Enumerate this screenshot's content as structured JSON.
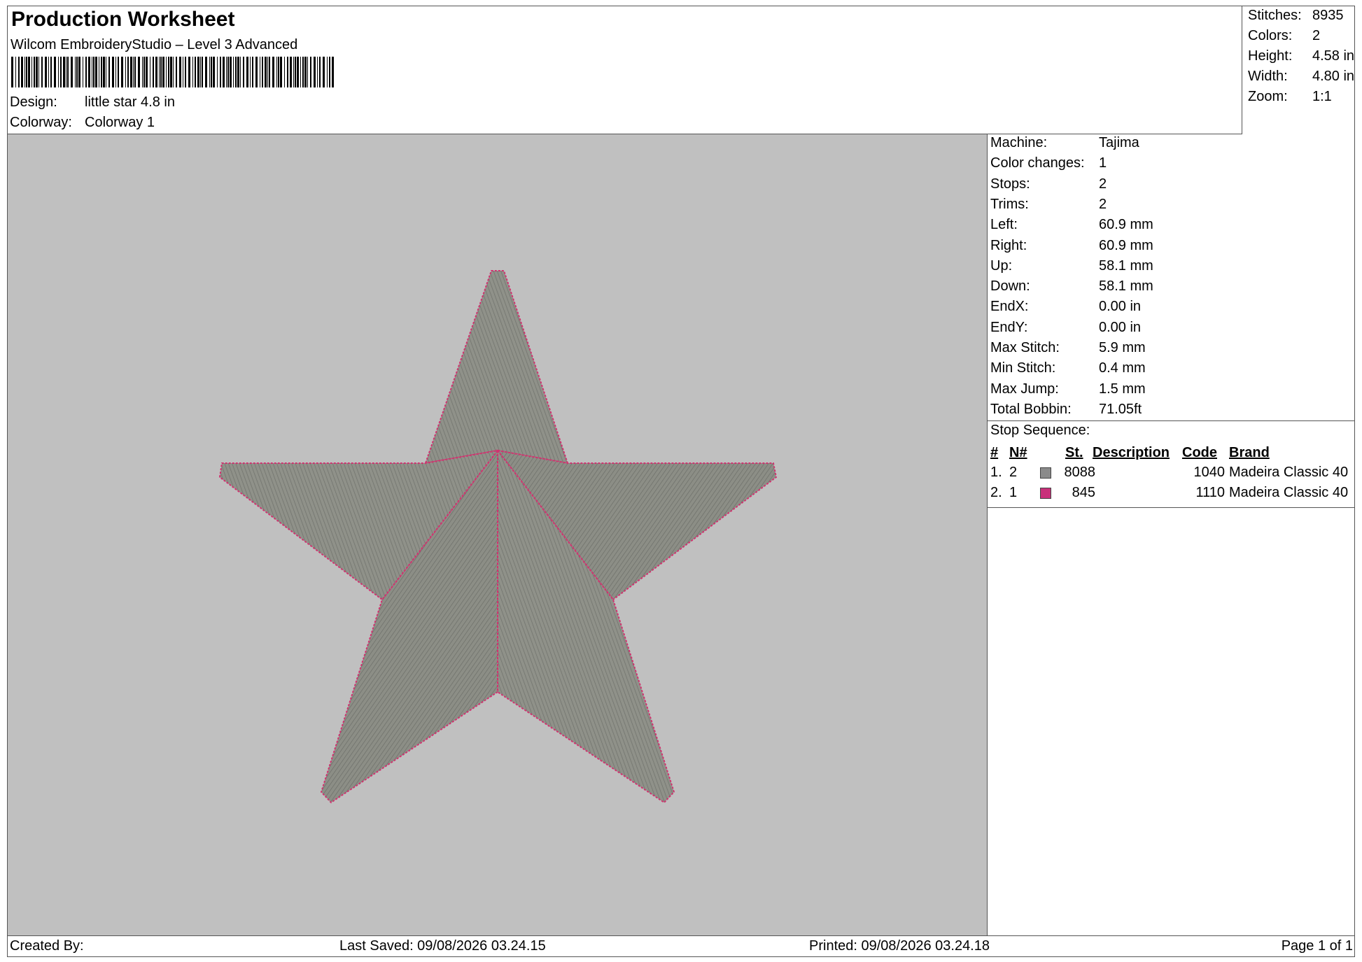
{
  "header": {
    "title": "Production Worksheet",
    "software": "Wilcom EmbroideryStudio – Level 3 Advanced",
    "design_label": "Design:",
    "design_value": "little star 4.8 in",
    "colorway_label": "Colorway:",
    "colorway_value": "Colorway 1"
  },
  "stats": [
    {
      "label": "Stitches:",
      "value": "8935"
    },
    {
      "label": "Colors:",
      "value": "2"
    },
    {
      "label": "Height:",
      "value": "4.58 in"
    },
    {
      "label": "Width:",
      "value": "4.80 in"
    },
    {
      "label": "Zoom:",
      "value": "1:1"
    }
  ],
  "machine_info": [
    {
      "label": "Machine:",
      "value": "Tajima"
    },
    {
      "label": "Color changes:",
      "value": "1"
    },
    {
      "label": "Stops:",
      "value": "2"
    },
    {
      "label": "Trims:",
      "value": "2"
    },
    {
      "label": "Left:",
      "value": "60.9 mm"
    },
    {
      "label": "Right:",
      "value": "60.9 mm"
    },
    {
      "label": "Up:",
      "value": "58.1 mm"
    },
    {
      "label": "Down:",
      "value": "58.1 mm"
    },
    {
      "label": "EndX:",
      "value": "0.00 in"
    },
    {
      "label": "EndY:",
      "value": "0.00 in"
    },
    {
      "label": "Max Stitch:",
      "value": "5.9 mm"
    },
    {
      "label": "Min Stitch:",
      "value": "0.4 mm"
    },
    {
      "label": "Max Jump:",
      "value": "1.5 mm"
    },
    {
      "label": "Total Bobbin:",
      "value": "71.05ft"
    }
  ],
  "stop_sequence": {
    "heading": "Stop Sequence:",
    "columns": {
      "num": "#",
      "n": "N#",
      "st": "St.",
      "description": "Description",
      "code": "Code",
      "brand": "Brand"
    },
    "rows": [
      {
        "num": "1.",
        "n": "2",
        "color": "#8a8a8a",
        "st": "8088",
        "description": "",
        "code": "1040",
        "brand": "Madeira Classic 40"
      },
      {
        "num": "2.",
        "n": "1",
        "color": "#c8307a",
        "st": "845",
        "description": "",
        "code": "1110",
        "brand": "Madeira Classic 40"
      }
    ]
  },
  "design_colors": {
    "canvas_bg": "#c0c0c0",
    "fill": "#8e9088",
    "outline": "#d0336f"
  },
  "footer": {
    "created_by": "Created By:",
    "last_saved": "Last Saved: 09/08/2026 03.24.15",
    "printed": "Printed: 09/08/2026 03.24.18",
    "page": "Page 1 of 1"
  }
}
